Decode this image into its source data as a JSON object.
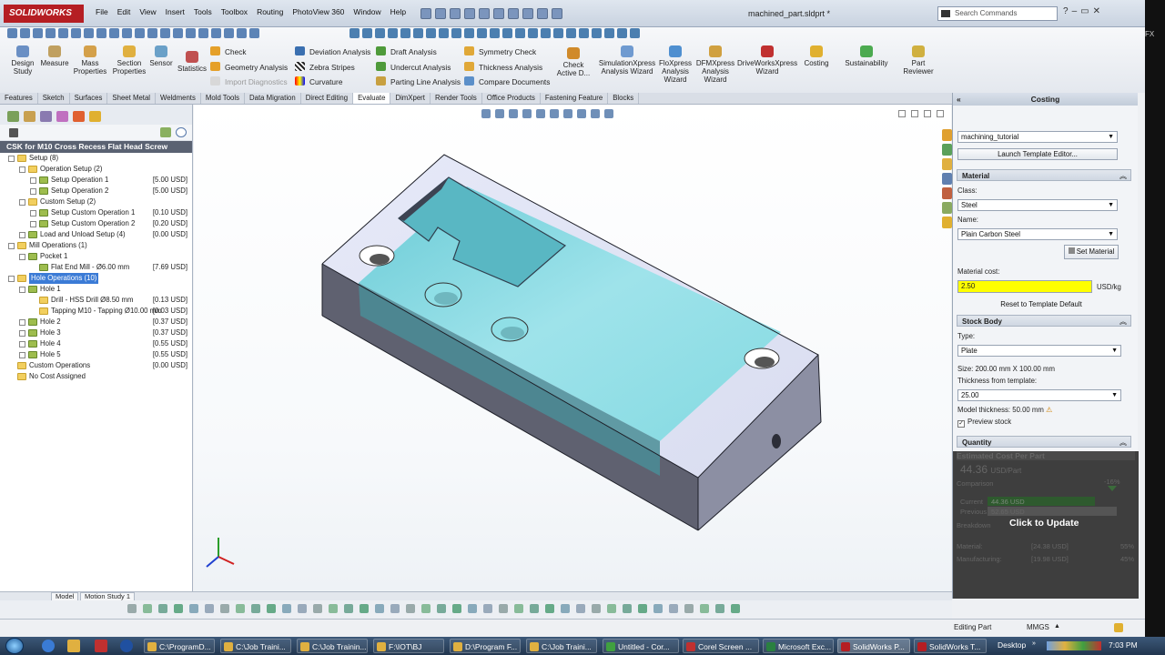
{
  "app": {
    "logo": "SOLIDWORKS",
    "document_title": "machined_part.sldprt *",
    "search_placeholder": "Search Commands",
    "menu": [
      "File",
      "Edit",
      "View",
      "Insert",
      "Tools",
      "Toolbox",
      "Routing",
      "PhotoView 360",
      "Window",
      "Help"
    ],
    "win_controls": [
      "?",
      "–",
      "▭",
      "✕"
    ],
    "side_strip_text": "FX"
  },
  "ribbon": {
    "big_buttons": [
      {
        "label": "Design Study",
        "icon": "design-study-icon"
      },
      {
        "label": "Measure",
        "icon": "measure-icon"
      },
      {
        "label": "Mass Properties",
        "icon": "mass-properties-icon"
      },
      {
        "label": "Section Properties",
        "icon": "section-properties-icon"
      },
      {
        "label": "Sensor",
        "icon": "sensor-icon"
      },
      {
        "label": "Statistics",
        "icon": "statistics-icon"
      },
      {
        "label": "Check Active D...",
        "icon": "check-active-doc-icon"
      },
      {
        "label": "SimulationXpress Analysis Wizard",
        "icon": "simulationxpress-icon"
      },
      {
        "label": "FloXpress Analysis Wizard",
        "icon": "floxpress-icon"
      },
      {
        "label": "DFMXpress Analysis Wizard",
        "icon": "dfmxpress-icon"
      },
      {
        "label": "DriveWorksXpress Wizard",
        "icon": "driveworksxpress-icon"
      },
      {
        "label": "Costing",
        "icon": "costing-icon"
      },
      {
        "label": "Sustainability",
        "icon": "sustainability-icon"
      },
      {
        "label": "Part Reviewer",
        "icon": "part-reviewer-icon"
      }
    ],
    "small_buttons": [
      {
        "label": "Check",
        "icon": "check-icon"
      },
      {
        "label": "Geometry Analysis",
        "icon": "geometry-analysis-icon"
      },
      {
        "label": "Import Diagnostics",
        "icon": "import-diagnostics-icon",
        "disabled": true
      },
      {
        "label": "Deviation Analysis",
        "icon": "deviation-analysis-icon"
      },
      {
        "label": "Zebra Stripes",
        "icon": "zebra-stripes-icon"
      },
      {
        "label": "Curvature",
        "icon": "curvature-icon"
      },
      {
        "label": "Draft Analysis",
        "icon": "draft-analysis-icon"
      },
      {
        "label": "Undercut Analysis",
        "icon": "undercut-analysis-icon"
      },
      {
        "label": "Parting Line Analysis",
        "icon": "parting-line-icon"
      },
      {
        "label": "Symmetry Check",
        "icon": "symmetry-check-icon"
      },
      {
        "label": "Thickness Analysis",
        "icon": "thickness-analysis-icon"
      },
      {
        "label": "Compare Documents",
        "icon": "compare-documents-icon"
      }
    ],
    "tabs": [
      "Features",
      "Sketch",
      "Surfaces",
      "Sheet Metal",
      "Weldments",
      "Mold Tools",
      "Data Migration",
      "Direct Editing",
      "Evaluate",
      "DimXpert",
      "Render Tools",
      "Office Products",
      "Fastening Feature",
      "Blocks"
    ],
    "active_tab": "Evaluate"
  },
  "tree": {
    "header": "CSK for M10 Cross Recess Flat Head Screw",
    "rows": [
      {
        "label": "Setup (8)",
        "cost": ""
      },
      {
        "label": "Operation Setup (2)",
        "cost": ""
      },
      {
        "label": "Setup Operation 1",
        "cost": "[5.00 USD]"
      },
      {
        "label": "Setup Operation 2",
        "cost": "[5.00 USD]"
      },
      {
        "label": "Custom Setup (2)",
        "cost": ""
      },
      {
        "label": "Setup Custom Operation 1",
        "cost": "[0.10 USD]"
      },
      {
        "label": "Setup Custom Operation 2",
        "cost": "[0.20 USD]"
      },
      {
        "label": "Load and Unload Setup (4)",
        "cost": "[0.00 USD]"
      },
      {
        "label": "Mill Operations (1)",
        "cost": ""
      },
      {
        "label": "Pocket 1",
        "cost": ""
      },
      {
        "label": "Flat End Mill - Ø6.00 mm",
        "cost": "[7.69 USD]"
      },
      {
        "label": "Hole Operations (10)",
        "cost": ""
      },
      {
        "label": "Hole 1",
        "cost": ""
      },
      {
        "label": "Drill - HSS Drill Ø8.50 mm",
        "cost": "[0.13 USD]"
      },
      {
        "label": "Tapping M10 - Tapping Ø10.00 mm",
        "cost": "[0.03 USD]"
      },
      {
        "label": "Hole 2",
        "cost": "[0.37 USD]"
      },
      {
        "label": "Hole 3",
        "cost": "[0.37 USD]"
      },
      {
        "label": "Hole 4",
        "cost": "[0.55 USD]"
      },
      {
        "label": "Hole 5",
        "cost": "[0.55 USD]"
      },
      {
        "label": "Custom Operations",
        "cost": "[0.00 USD]"
      },
      {
        "label": "No Cost Assigned",
        "cost": ""
      }
    ]
  },
  "bottom_tabs": [
    "Model",
    "Motion Study 1"
  ],
  "costing": {
    "title": "Costing",
    "template": "machining_tutorial",
    "launch_template_editor": "Launch Template Editor...",
    "material_section": "Material",
    "class_label": "Class:",
    "class_value": "Steel",
    "name_label": "Name:",
    "name_value": "Plain Carbon Steel",
    "set_material": "Set Material",
    "material_cost_label": "Material cost:",
    "material_cost_value": "2.50",
    "material_cost_unit": "USD/kg",
    "reset_template": "Reset to Template Default",
    "stock_section": "Stock Body",
    "type_label": "Type:",
    "type_value": "Plate",
    "size_text": "Size: 200.00 mm X 100.00 mm",
    "thickness_label": "Thickness from template:",
    "thickness_value": "25.00",
    "model_thickness": "Model thickness: 50.00 mm",
    "preview_stock": "Preview stock",
    "quantity_section": "Quantity",
    "estimated_title": "Estimated Cost Per Part",
    "estimated_value": "44.36",
    "estimated_unit": "USD/Part",
    "comparison_label": "Comparison",
    "comparison_pct": "-16%",
    "current_label": "Current",
    "current_value": "44.36 USD",
    "previous_label": "Previous",
    "previous_value": "52.65 USD",
    "breakdown_label": "Breakdown",
    "material_row": "Material:",
    "material_row_value": "[24.38 USD]",
    "material_row_pct": "55%",
    "manufacturing_row": "Manufacturing:",
    "manufacturing_row_value": "[19.98 USD]",
    "manufacturing_row_pct": "45%",
    "click_to_update": "Click to Update"
  },
  "status": {
    "left": "Editing Part",
    "units": "MMGS"
  },
  "taskbar": {
    "items": [
      "C:\\ProgramD...",
      "C:\\Job Traini...",
      "C:\\Job Trainin...",
      "F:\\IOT\\BJ",
      "D:\\Program F...",
      "C:\\Job Traini...",
      "Untitled - Cor...",
      "Corel Screen ...",
      "Microsoft Exc...",
      "SolidWorks P...",
      "SolidWorks T..."
    ],
    "desktop": "Desktop",
    "clock": "7:03 PM"
  },
  "colors": {
    "accent_red": "#b51e23",
    "tree_header": "#5a6272",
    "selection": "#3b7bd6",
    "material_cost_highlight": "#ffff00",
    "pocket_cyan": "#7fd9e0"
  }
}
